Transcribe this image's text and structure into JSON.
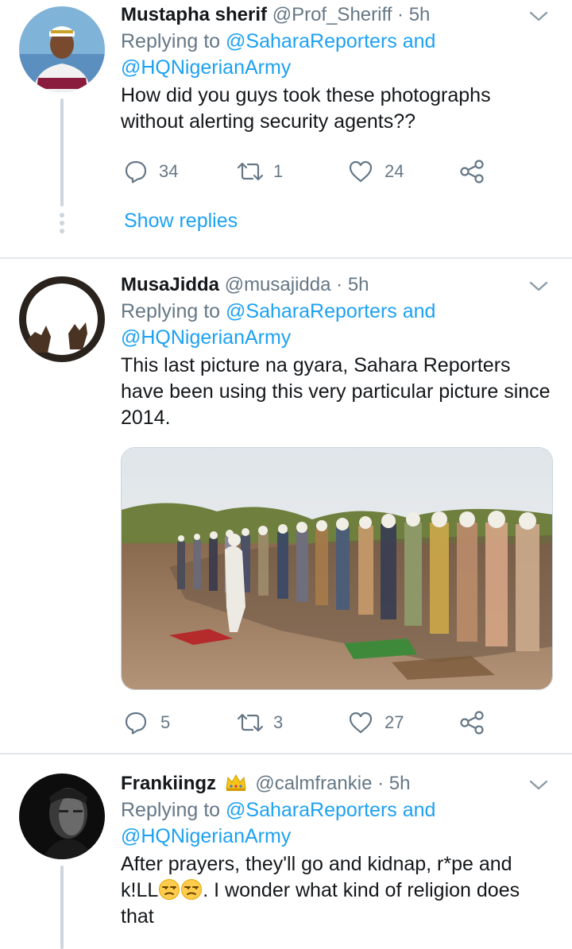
{
  "tweets": [
    {
      "name": "Mustapha sherif",
      "handle": "@Prof_Sheriff",
      "separator": "·",
      "time": "5h",
      "replying_prefix": "Replying to",
      "replying_to": "@SaharaReporters and @HQNigerianArmy",
      "text": "How did you guys took these photographs without alerting security agents??",
      "replies": "34",
      "retweets": "1",
      "likes": "24",
      "show_replies": "Show replies",
      "avatar_icon": "user-avatar-man-white-cap"
    },
    {
      "name": "MusaJidda",
      "handle": "@musajidda",
      "separator": "·",
      "time": "5h",
      "replying_prefix": "Replying to",
      "replying_to": "@SaharaReporters and @HQNigerianArmy",
      "text": "This last picture na gyara, Sahara Reporters have been using this very particular picture since 2014.",
      "media_icon": "photo-men-praying-outdoors",
      "replies": "5",
      "retweets": "3",
      "likes": "27",
      "avatar_icon": "user-avatar-raised-hands"
    },
    {
      "name": "Frankiingz",
      "name_badge_icon": "crown-emoji",
      "handle": "@calmfrankie",
      "separator": "·",
      "time": "5h",
      "replying_prefix": "Replying to",
      "replying_to": "@SaharaReporters and @HQNigerianArmy",
      "text_before_emoji": "After prayers, they'll go and kidnap, r*pe and k!LL",
      "emoji_icons": [
        "unamused-face-emoji",
        "unamused-face-emoji"
      ],
      "text_after_emoji": ". I wonder what kind of religion does that",
      "avatar_icon": "user-avatar-dark-portrait"
    }
  ],
  "colors": {
    "link": "#1da1f2",
    "secondary_text": "#657786",
    "primary_text": "#14171a",
    "divider": "#e1e8ed",
    "thread_line": "#cdd6dd"
  }
}
